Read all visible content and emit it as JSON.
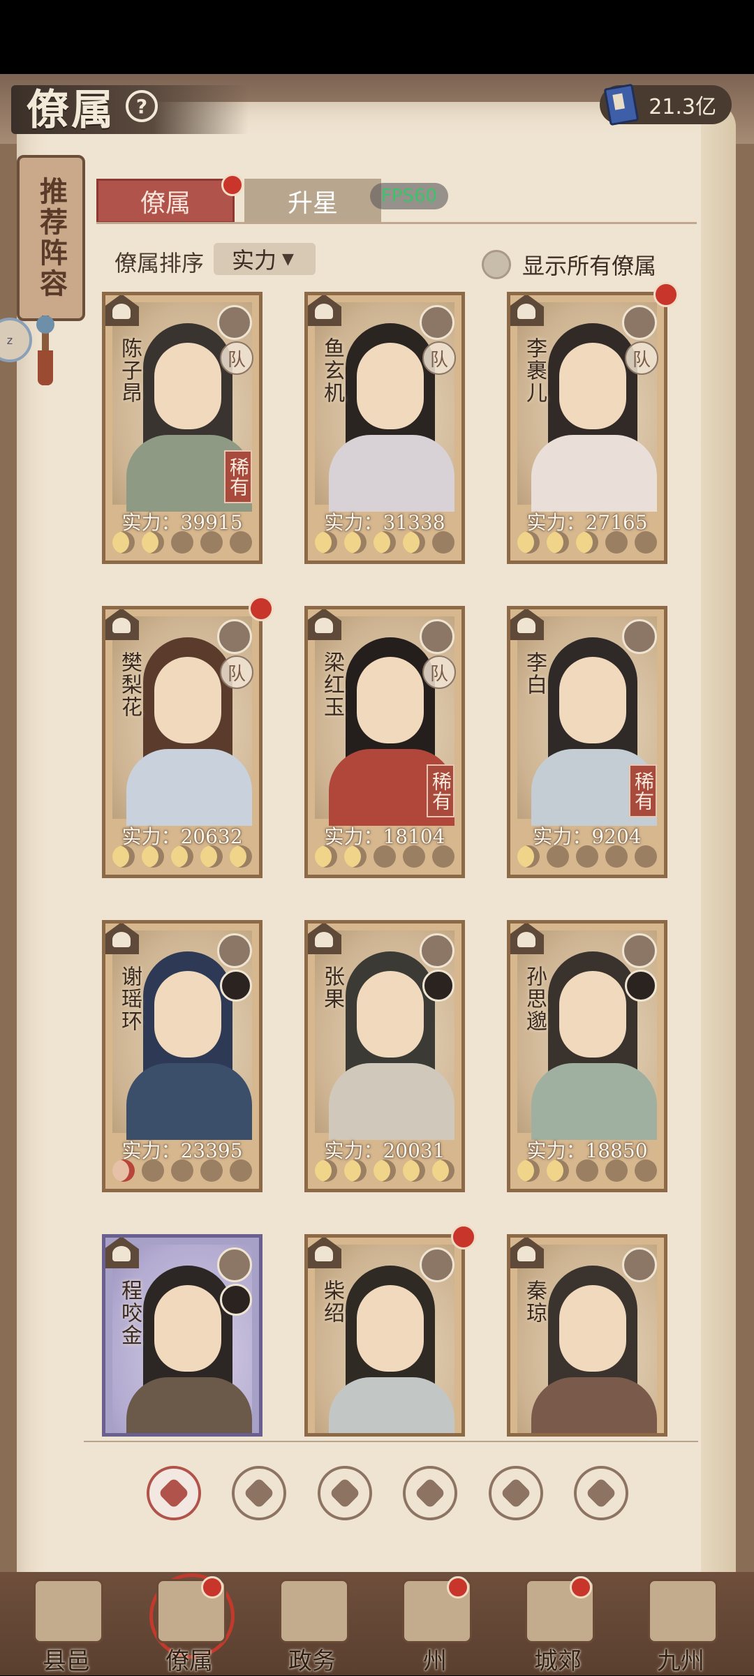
{
  "header": {
    "title": "僚属",
    "currency_value": "21.3亿",
    "side_scroll_label": "推荐阵容",
    "side_bubble_text": "z"
  },
  "tabs": [
    {
      "label": "僚属",
      "active": true,
      "has_dot": true
    },
    {
      "label": "升星",
      "active": false,
      "has_dot": false
    }
  ],
  "fps_label": "FPS60",
  "sort": {
    "label": "僚属排序",
    "value": "实力"
  },
  "show_all": {
    "label": "显示所有僚属",
    "checked": false
  },
  "cards": [
    {
      "name": "陈子昂",
      "power": "实力：39915",
      "stars": 2,
      "rare": "稀有",
      "team": "队",
      "dot": false,
      "purple": false,
      "badge": "scroll-icon"
    },
    {
      "name": "鱼玄机",
      "power": "实力：31338",
      "stars": 4,
      "rare": "",
      "team": "队",
      "dot": false,
      "purple": false,
      "badge": "cauldron-icon"
    },
    {
      "name": "李裹儿",
      "power": "实力：27165",
      "stars": 3,
      "rare": "",
      "team": "队",
      "dot": true,
      "purple": false,
      "badge": "yin-yang-icon"
    },
    {
      "name": "樊梨花",
      "power": "实力：20632",
      "stars": 5,
      "rare": "",
      "team": "队",
      "dot": true,
      "purple": false,
      "badge": "shield-icon"
    },
    {
      "name": "梁红玉",
      "power": "实力：18104",
      "stars": 2,
      "rare": "稀有",
      "team": "队",
      "dot": false,
      "purple": false,
      "badge": "shield-icon"
    },
    {
      "name": "李白",
      "power": "实力：9204",
      "stars": 1,
      "rare": "稀有",
      "team": "",
      "dot": false,
      "purple": false,
      "badge": "scroll-icon"
    },
    {
      "name": "谢瑶环",
      "power": "实力：23395",
      "stars": 1,
      "red_star": true,
      "rare": "",
      "team": "",
      "avatar": true,
      "dot": false,
      "purple": false,
      "badge": "scroll-icon"
    },
    {
      "name": "张果",
      "power": "实力：20031",
      "stars": 5,
      "rare": "",
      "team": "",
      "avatar": true,
      "dot": false,
      "purple": false,
      "badge": "yin-yang-icon"
    },
    {
      "name": "孙思邈",
      "power": "实力：18850",
      "stars": 2,
      "rare": "",
      "team": "",
      "avatar": true,
      "dot": false,
      "purple": false,
      "badge": "cauldron-icon"
    },
    {
      "name": "程咬金",
      "power": "",
      "stars": 0,
      "rare": "",
      "team": "",
      "avatar": true,
      "dot": false,
      "purple": true,
      "badge": "shield-icon"
    },
    {
      "name": "柴绍",
      "power": "",
      "stars": 0,
      "rare": "",
      "team": "",
      "dot": true,
      "purple": false,
      "badge": "sword-icon"
    },
    {
      "name": "秦琼",
      "power": "",
      "stars": 0,
      "rare": "",
      "team": "",
      "dot": false,
      "purple": false,
      "badge": "scroll-icon"
    }
  ],
  "filters": [
    {
      "icon": "all-icon",
      "active": true
    },
    {
      "icon": "scholar-icon",
      "active": false
    },
    {
      "icon": "taoist-icon",
      "active": false
    },
    {
      "icon": "fan-icon",
      "active": false
    },
    {
      "icon": "lion-icon",
      "active": false
    },
    {
      "icon": "leaf-icon",
      "active": false
    }
  ],
  "nav": [
    {
      "label": "县邑",
      "dot": false,
      "active": false
    },
    {
      "label": "僚属",
      "dot": true,
      "active": true
    },
    {
      "label": "政务",
      "dot": false,
      "active": false
    },
    {
      "label": "州",
      "dot": true,
      "active": false
    },
    {
      "label": "城郊",
      "dot": true,
      "active": false
    },
    {
      "label": "九州",
      "dot": false,
      "active": false
    }
  ],
  "colors": {
    "accent": "#b0534a",
    "rare_bg": "#a84a3c",
    "star_lit": "#efd48a",
    "notify": "#c7352b"
  }
}
